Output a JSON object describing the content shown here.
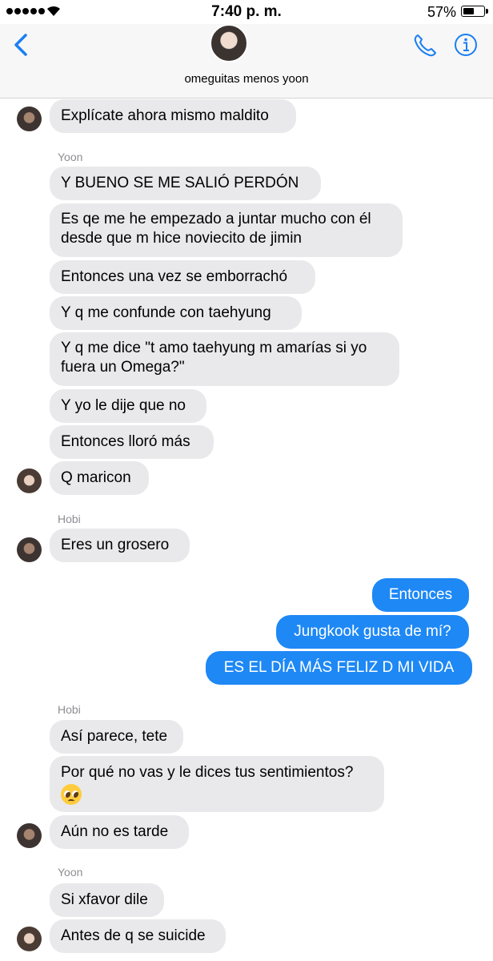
{
  "status_bar": {
    "time": "7:40 p. m.",
    "battery": "57%"
  },
  "header": {
    "group_name": "omeguitas menos yoon"
  },
  "colors": {
    "sent_bubble": "#1e88f5",
    "received_bubble": "#e9e9eb",
    "accent": "#1a7ff3",
    "sender_name": "#8e8e93"
  },
  "icons": {
    "back": "chevron-left-icon",
    "call": "phone-icon",
    "info": "info-icon",
    "emoji": "pleading-face-emoji"
  },
  "messages": [
    {
      "side": "received",
      "text": "Explícate ahora mismo maldito"
    },
    {
      "side": "received",
      "sender": "Yoon",
      "text": "Y BUENO SE ME SALIÓ PERDÓN"
    },
    {
      "side": "received",
      "text": "Es qe me he empezado a juntar mucho con él desde que m hice noviecito de jimin"
    },
    {
      "side": "received",
      "text": "Entonces una vez se emborrachó"
    },
    {
      "side": "received",
      "text": "Y q me confunde con taehyung"
    },
    {
      "side": "received",
      "text": "Y q me dice \"t amo taehyung m amarías si yo fuera un Omega?\""
    },
    {
      "side": "received",
      "text": "Y yo le dije que no"
    },
    {
      "side": "received",
      "text": "Entonces lloró más"
    },
    {
      "side": "received",
      "text": "Q maricon"
    },
    {
      "side": "received",
      "sender": "Hobi",
      "text": "Eres un grosero"
    },
    {
      "side": "sent",
      "text": "Entonces"
    },
    {
      "side": "sent",
      "text": "Jungkook gusta de mí?"
    },
    {
      "side": "sent",
      "text": "ES EL DÍA MÁS FELIZ D MI VIDA"
    },
    {
      "side": "received",
      "sender": "Hobi",
      "text": "Así parece, tete"
    },
    {
      "side": "received",
      "text": "Por qué no vas y le dices tus sentimientos?"
    },
    {
      "side": "received",
      "text": "Aún no es tarde"
    },
    {
      "side": "received",
      "sender": "Yoon",
      "text": "Si xfavor dile"
    },
    {
      "side": "received",
      "text": "Antes de q se suicide"
    }
  ]
}
